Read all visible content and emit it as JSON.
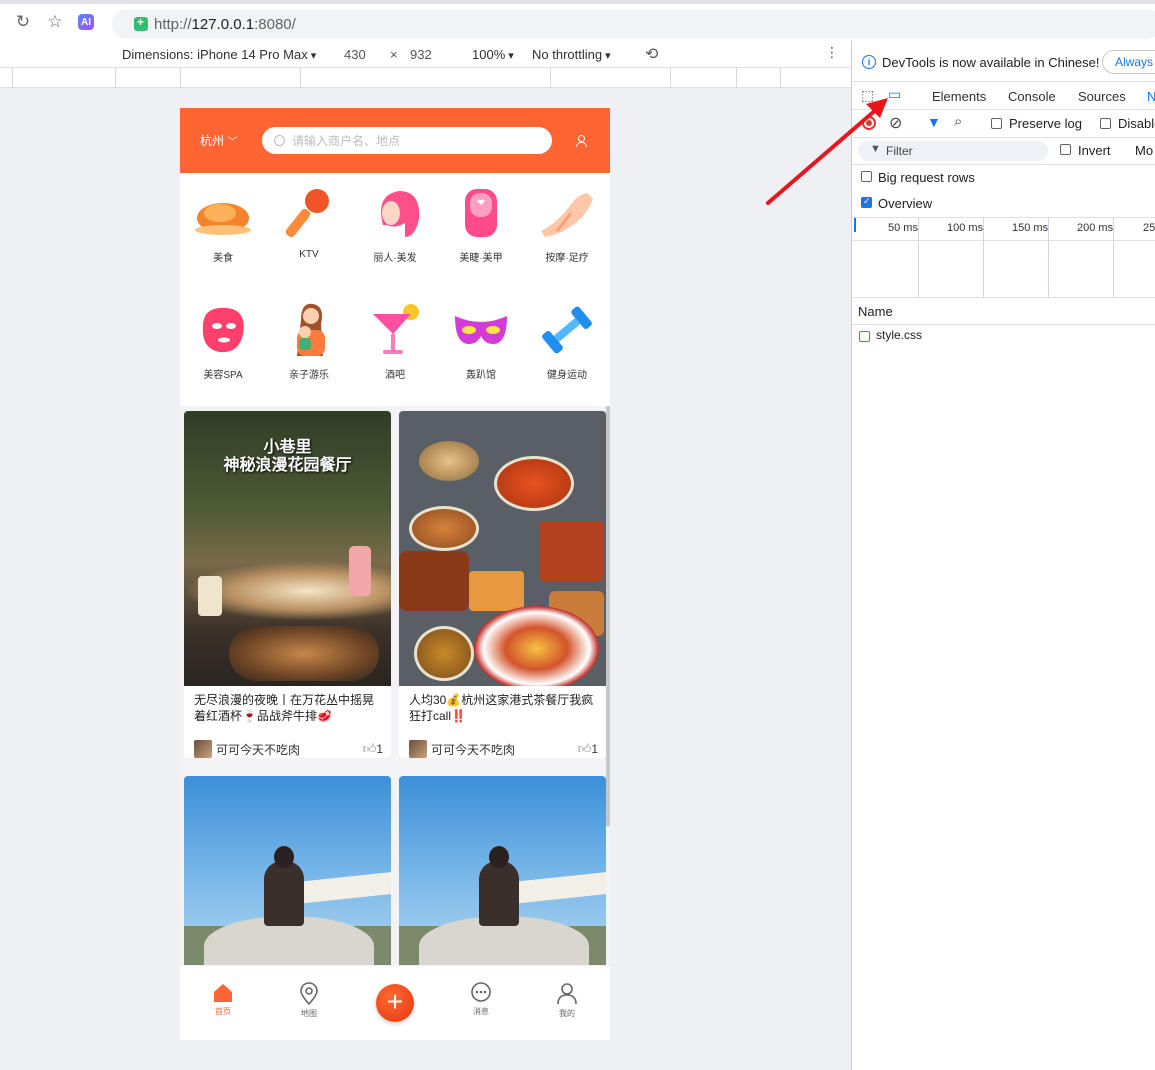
{
  "browser": {
    "url_prefix": "http://",
    "url_host": "127.0.0.1",
    "url_suffix": ":8080/",
    "ai_label": "AI"
  },
  "device_toolbar": {
    "dimensions": "Dimensions: iPhone 14 Pro Max",
    "width": "430",
    "times": "×",
    "height": "932",
    "zoom": "100%",
    "throttling": "No throttling"
  },
  "app": {
    "city": "杭州",
    "search_placeholder": "请输入商户名、地点",
    "accent": "#ff6533",
    "categories": [
      {
        "label": "美食",
        "icon": "roast-chicken-icon"
      },
      {
        "label": "KTV",
        "icon": "microphone-icon"
      },
      {
        "label": "丽人·美发",
        "icon": "hair-icon"
      },
      {
        "label": "美睫·美甲",
        "icon": "nail-icon"
      },
      {
        "label": "按摩·足疗",
        "icon": "massage-hand-icon"
      },
      {
        "label": "美容SPA",
        "icon": "face-mask-icon"
      },
      {
        "label": "亲子游乐",
        "icon": "parent-child-icon"
      },
      {
        "label": "酒吧",
        "icon": "cocktail-icon"
      },
      {
        "label": "轰趴馆",
        "icon": "party-mask-icon"
      },
      {
        "label": "健身运动",
        "icon": "dumbbell-icon"
      }
    ],
    "cards": [
      {
        "image_text_1": "小巷里",
        "image_text_2": "神秘浪漫花园餐厅",
        "title": "无尽浪漫的夜晚丨在万花丛中摇晃着红酒杯🍷品战斧牛排🥩",
        "author": "可可今天不吃肉",
        "likes": "1"
      },
      {
        "image_text_1": "",
        "image_text_2": "",
        "title": "人均30💰杭州这家港式茶餐厅我疯狂打call‼️",
        "author": "可可今天不吃肉",
        "likes": "1"
      },
      {
        "title": "",
        "author": "",
        "likes": ""
      },
      {
        "title": "",
        "author": "",
        "likes": ""
      }
    ],
    "tabs": [
      {
        "label": "首页",
        "icon": "home-icon",
        "active": true
      },
      {
        "label": "地图",
        "icon": "map-pin-icon",
        "active": false
      },
      {
        "label": "+",
        "icon": "plus-icon"
      },
      {
        "label": "消息",
        "icon": "message-icon",
        "active": false
      },
      {
        "label": "我的",
        "icon": "user-icon",
        "active": false
      }
    ]
  },
  "devtools": {
    "notice": "DevTools is now available in Chinese!",
    "always_btn": "Always",
    "tabs": [
      "Elements",
      "Console",
      "Sources",
      "N"
    ],
    "preserve_log": "Preserve log",
    "disable_cache": "Disable",
    "filter_placeholder": "Filter",
    "invert": "Invert",
    "more": "Mo",
    "big_request_rows": "Big request rows",
    "overview": "Overview",
    "timeline_labels": [
      "50 ms",
      "100 ms",
      "150 ms",
      "200 ms",
      "25"
    ],
    "name_header": "Name",
    "requests": [
      "style.css"
    ]
  }
}
